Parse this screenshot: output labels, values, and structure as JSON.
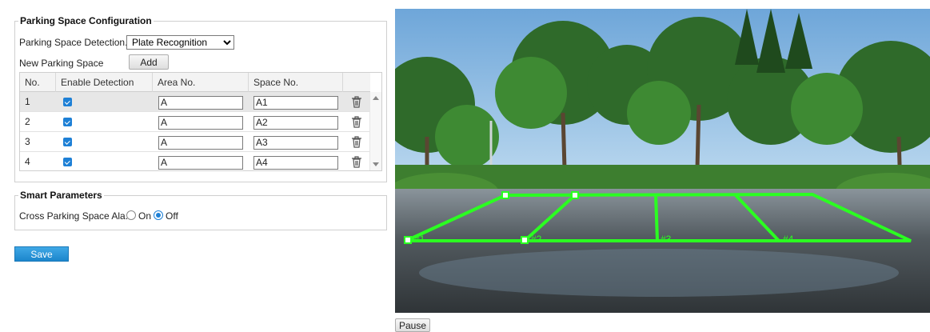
{
  "parking_config": {
    "legend": "Parking Space Configuration",
    "detection_label": "Parking Space Detection...",
    "detection_value": "Plate Recognition",
    "new_space_label": "New Parking Space",
    "add_label": "Add",
    "columns": [
      "No.",
      "Enable Detection",
      "Area No.",
      "Space No."
    ],
    "rows": [
      {
        "no": "1",
        "enabled": true,
        "area": "A",
        "space": "A1"
      },
      {
        "no": "2",
        "enabled": true,
        "area": "A",
        "space": "A2"
      },
      {
        "no": "3",
        "enabled": true,
        "area": "A",
        "space": "A3"
      },
      {
        "no": "4",
        "enabled": true,
        "area": "A",
        "space": "A4"
      }
    ]
  },
  "smart_params": {
    "legend": "Smart Parameters",
    "cross_label": "Cross Parking Space Ala...",
    "on_label": "On",
    "off_label": "Off",
    "selected": "Off"
  },
  "save_label": "Save",
  "pause_label": "Pause",
  "video": {
    "space_labels": [
      "#1",
      "#2",
      "#3",
      "#4"
    ],
    "overlay_color": "#2bff21"
  }
}
